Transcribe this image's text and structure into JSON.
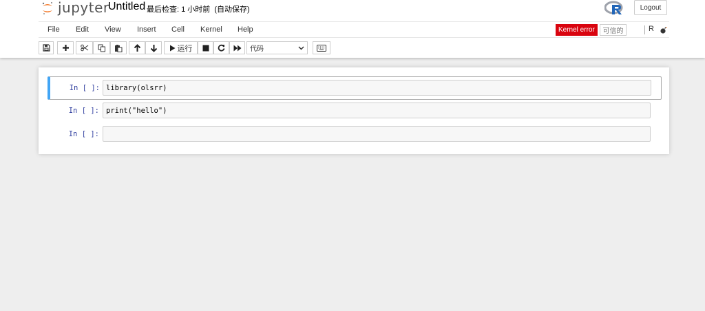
{
  "header": {
    "logo_text": "jupyter",
    "notebook_title": "Untitled",
    "checkpoint_text": "最后检查: 1 小时前",
    "autosave_text": "(自动保存)",
    "logout_label": "Logout"
  },
  "menubar": {
    "items": [
      "File",
      "Edit",
      "View",
      "Insert",
      "Cell",
      "Kernel",
      "Help"
    ],
    "kernel_status": "Kernel error",
    "trusted_label": "可信的",
    "kernel_name": "R"
  },
  "toolbar": {
    "run_label": "运行",
    "cell_type_value": "代码"
  },
  "cells": [
    {
      "prompt": "In [ ]:",
      "source": "library(olsrr)",
      "selected": true
    },
    {
      "prompt": "In [ ]:",
      "source": "print(\"hello\")",
      "selected": false
    },
    {
      "prompt": "In [ ]:",
      "source": "",
      "selected": false
    }
  ],
  "colors": {
    "accent_blue": "#42a5f5",
    "kernel_error_red": "#d9040f",
    "jupyter_orange": "#f37726",
    "prompt_blue": "#303f9f"
  }
}
